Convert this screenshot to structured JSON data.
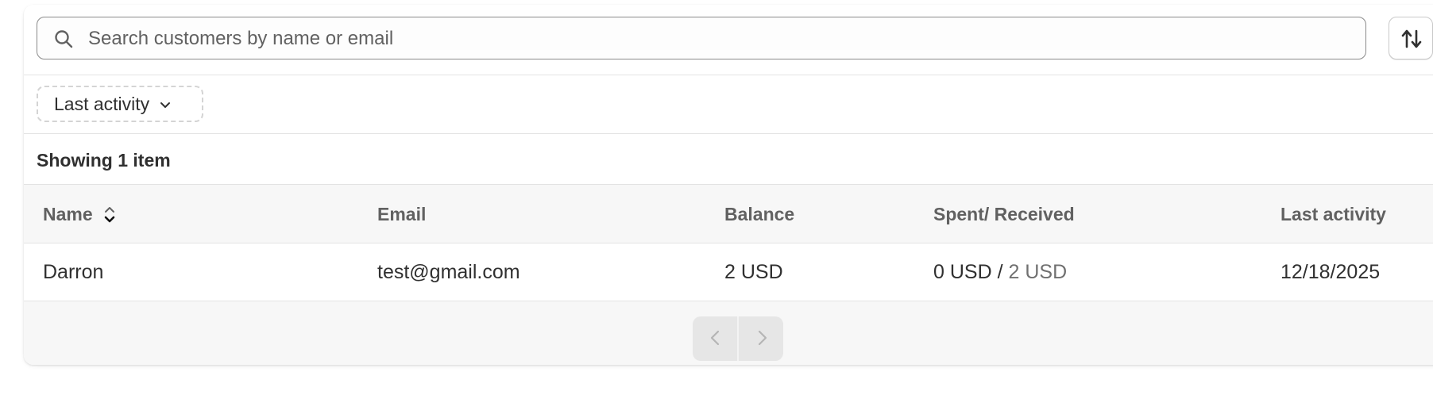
{
  "search": {
    "placeholder": "Search customers by name or email",
    "value": ""
  },
  "sort_button": {
    "icon": "sort-arrows-icon"
  },
  "filters": {
    "last_activity_label": "Last activity"
  },
  "list": {
    "count_text": "Showing 1 item"
  },
  "table": {
    "columns": [
      "Name",
      "Email",
      "Balance",
      "Spent/ Received",
      "Last activity"
    ],
    "rows": [
      {
        "name": "Darron",
        "email": "test@gmail.com",
        "balance": "2 USD",
        "spent": "0 USD",
        "separator": " / ",
        "received": "2 USD",
        "last_activity": "12/18/2025"
      }
    ]
  },
  "pagination": {
    "prev_icon": "chevron-left-icon",
    "next_icon": "chevron-right-icon"
  },
  "colors": {
    "text_primary": "#303030",
    "text_secondary": "#616161",
    "header_bg": "#f7f7f7",
    "border": "#e3e3e3"
  }
}
